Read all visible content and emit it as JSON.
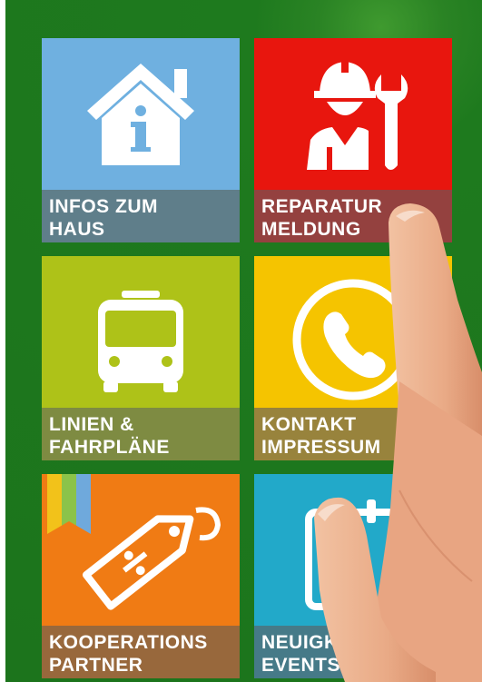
{
  "colors": {
    "background": "#1f7a1f",
    "infos": "#6fb0e0",
    "reparatur": "#e8160e",
    "linien": "#aec218",
    "kontakt": "#f5c400",
    "kooperations": "#f07b14",
    "neuigkeiten": "#22a9c9"
  },
  "tiles": [
    {
      "label": "INFOS ZUM\nHAUS",
      "icon": "house-info-icon"
    },
    {
      "label": "REPARATUR\nMELDUNG",
      "icon": "repairman-wrench-icon"
    },
    {
      "label": "LINIEN &\nFAHRPLÄNE",
      "icon": "bus-icon"
    },
    {
      "label": "KONTAKT\nIMPRESSUM",
      "icon": "phone-circle-icon"
    },
    {
      "label": "KOOPERATIONS\nPARTNER",
      "icon": "discount-tag-icon"
    },
    {
      "label": "NEUIGK\nEVENTS",
      "icon": "calendar-icon"
    }
  ]
}
